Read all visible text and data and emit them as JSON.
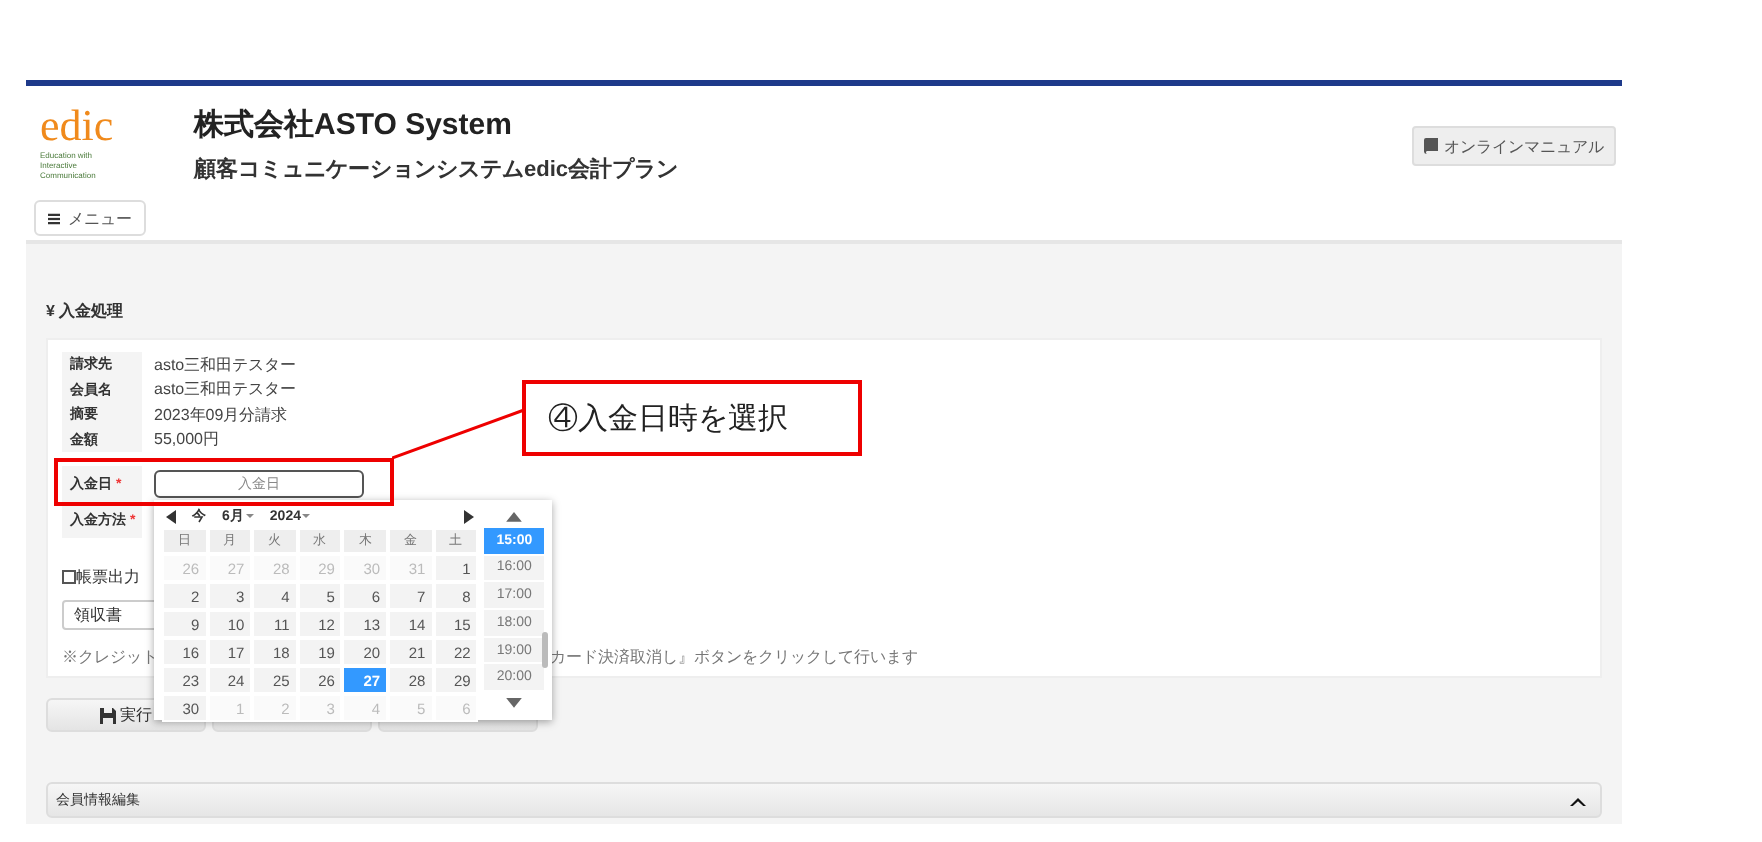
{
  "header": {
    "logo": "edic",
    "tagline": [
      "Education with",
      "Interactive",
      "Communication"
    ],
    "company": "株式会社ASTO System",
    "subtitle": "顧客コミュニケーションシステムedic会計プラン",
    "manual_button": "オンラインマニュアル",
    "menu_button": "メニュー"
  },
  "section_title": "¥ 入金処理",
  "info_rows": [
    {
      "label": "請求先",
      "value": "asto三和田テスター"
    },
    {
      "label": "会員名",
      "value": "asto三和田テスター"
    },
    {
      "label": "摘要",
      "value": "2023年09月分請求"
    },
    {
      "label": "金額",
      "value": "55,000円"
    }
  ],
  "date_field": {
    "label": "入金日",
    "required": "*",
    "placeholder": "入金日"
  },
  "method_field": {
    "label": "入金方法",
    "required": "*"
  },
  "print_checkbox": {
    "label": "帳票出力",
    "checked": false
  },
  "document_select": {
    "value": "領収書"
  },
  "note": {
    "left": "※クレジット",
    "right": "カード決済取消し』ボタンをクリックして行います"
  },
  "buttons": [
    {
      "kind": "save",
      "label": "実行"
    },
    {
      "kind": "hidden"
    },
    {
      "kind": "hidden"
    }
  ],
  "calendar": {
    "today": "今",
    "month": "6月",
    "year": "2024",
    "weekdays": [
      "日",
      "月",
      "火",
      "水",
      "木",
      "金",
      "土"
    ],
    "weeks": [
      [
        {
          "label": "26",
          "muted": true,
          "selected": false
        },
        {
          "label": "27",
          "muted": true,
          "selected": false
        },
        {
          "label": "28",
          "muted": true,
          "selected": false
        },
        {
          "label": "29",
          "muted": true,
          "selected": false
        },
        {
          "label": "30",
          "muted": true,
          "selected": false
        },
        {
          "label": "31",
          "muted": true,
          "selected": false
        },
        {
          "label": "1",
          "muted": false,
          "selected": false
        }
      ],
      [
        {
          "label": "2",
          "muted": false,
          "selected": false
        },
        {
          "label": "3",
          "muted": false,
          "selected": false
        },
        {
          "label": "4",
          "muted": false,
          "selected": false
        },
        {
          "label": "5",
          "muted": false,
          "selected": false
        },
        {
          "label": "6",
          "muted": false,
          "selected": false
        },
        {
          "label": "7",
          "muted": false,
          "selected": false
        },
        {
          "label": "8",
          "muted": false,
          "selected": false
        }
      ],
      [
        {
          "label": "9",
          "muted": false,
          "selected": false
        },
        {
          "label": "10",
          "muted": false,
          "selected": false
        },
        {
          "label": "11",
          "muted": false,
          "selected": false
        },
        {
          "label": "12",
          "muted": false,
          "selected": false
        },
        {
          "label": "13",
          "muted": false,
          "selected": false
        },
        {
          "label": "14",
          "muted": false,
          "selected": false
        },
        {
          "label": "15",
          "muted": false,
          "selected": false
        }
      ],
      [
        {
          "label": "16",
          "muted": false,
          "selected": false
        },
        {
          "label": "17",
          "muted": false,
          "selected": false
        },
        {
          "label": "18",
          "muted": false,
          "selected": false
        },
        {
          "label": "19",
          "muted": false,
          "selected": false
        },
        {
          "label": "20",
          "muted": false,
          "selected": false
        },
        {
          "label": "21",
          "muted": false,
          "selected": false
        },
        {
          "label": "22",
          "muted": false,
          "selected": false
        }
      ],
      [
        {
          "label": "23",
          "muted": false,
          "selected": false
        },
        {
          "label": "24",
          "muted": false,
          "selected": false
        },
        {
          "label": "25",
          "muted": false,
          "selected": false
        },
        {
          "label": "26",
          "muted": false,
          "selected": false
        },
        {
          "label": "27",
          "muted": false,
          "selected": true
        },
        {
          "label": "28",
          "muted": false,
          "selected": false
        },
        {
          "label": "29",
          "muted": false,
          "selected": false
        }
      ],
      [
        {
          "label": "30",
          "muted": false,
          "selected": false
        },
        {
          "label": "1",
          "muted": true,
          "selected": false
        },
        {
          "label": "2",
          "muted": true,
          "selected": false
        },
        {
          "label": "3",
          "muted": true,
          "selected": false
        },
        {
          "label": "4",
          "muted": true,
          "selected": false
        },
        {
          "label": "5",
          "muted": true,
          "selected": false
        },
        {
          "label": "6",
          "muted": true,
          "selected": false
        }
      ]
    ],
    "times": [
      {
        "label": "15:00",
        "selected": true
      },
      {
        "label": "16:00",
        "selected": false
      },
      {
        "label": "17:00",
        "selected": false
      },
      {
        "label": "18:00",
        "selected": false
      },
      {
        "label": "19:00",
        "selected": false
      },
      {
        "label": "20:00",
        "selected": false
      }
    ]
  },
  "accordion": {
    "title": "会員情報編集",
    "expanded": true
  },
  "annotation": {
    "text": "④入金日時を選択"
  }
}
